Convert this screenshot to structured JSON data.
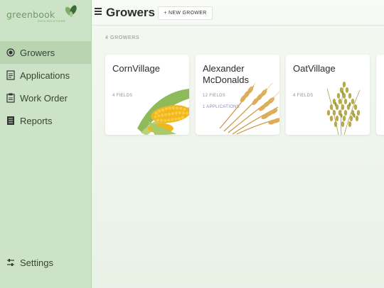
{
  "brand": {
    "wordmark": "greenbook",
    "tagline": "DATA SOLUTIONS"
  },
  "sidebar": {
    "items": [
      {
        "label": "Growers",
        "icon": "target-icon",
        "active": true
      },
      {
        "label": "Applications",
        "icon": "document-icon",
        "active": false
      },
      {
        "label": "Work Order",
        "icon": "clipboard-icon",
        "active": false
      },
      {
        "label": "Reports",
        "icon": "report-icon",
        "active": false
      }
    ],
    "settings": {
      "label": "Settings",
      "icon": "sliders-icon"
    }
  },
  "header": {
    "title": "Growers",
    "new_button": "+ NEW GROWER"
  },
  "summary": {
    "count_label": "4 GROWERS"
  },
  "growers": [
    {
      "name": "CornVillage",
      "fields": "4 FIELDS",
      "applications": "",
      "image": "corn-image"
    },
    {
      "name": "Alexander McDonalds",
      "fields": "12 FIELDS",
      "applications": "1 APPLICATIONS",
      "image": "wheat-image"
    },
    {
      "name": "OatVillage",
      "fields": "4 FIELDS",
      "applications": "",
      "image": "oat-image"
    }
  ],
  "colors": {
    "sidebar_bg": "#cde3c7",
    "sidebar_active": "#b8d4b1",
    "main_bg": "#eef4ec",
    "accent": "#6f9a66",
    "applications_text": "#8b8ad4"
  }
}
